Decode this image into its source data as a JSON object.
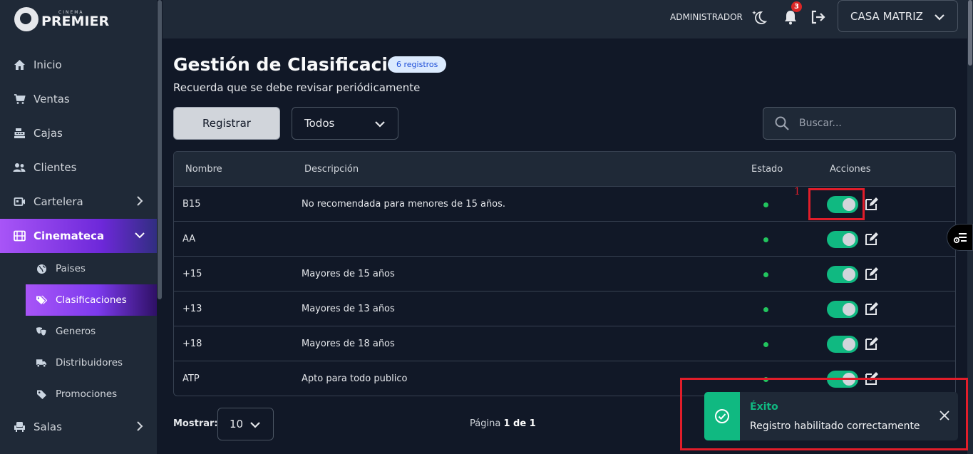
{
  "brand": {
    "small": "CINEMA",
    "big": "PREMIER"
  },
  "sidebar": {
    "items": [
      {
        "label": "Inicio",
        "icon": "home-icon"
      },
      {
        "label": "Ventas",
        "icon": "cart-icon"
      },
      {
        "label": "Cajas",
        "icon": "cash-register-icon"
      },
      {
        "label": "Clientes",
        "icon": "users-icon"
      },
      {
        "label": "Cartelera",
        "icon": "ticket-icon"
      },
      {
        "label": "Cinemateca",
        "icon": "film-icon"
      },
      {
        "label": "Salas",
        "icon": "chair-icon"
      }
    ],
    "subitems": [
      {
        "label": "Paises",
        "icon": "globe-icon"
      },
      {
        "label": "Clasificaciones",
        "icon": "tags-icon"
      },
      {
        "label": "Generos",
        "icon": "masks-icon"
      },
      {
        "label": "Distribuidores",
        "icon": "truck-icon"
      },
      {
        "label": "Promociones",
        "icon": "tag-icon"
      }
    ]
  },
  "topbar": {
    "user": "ADMINISTRADOR",
    "notifications": "3",
    "branch": "CASA MATRIZ"
  },
  "main": {
    "title": "Gestión de Clasificación",
    "count": "6 registros",
    "subtitle": "Recuerda que se debe revisar periódicamente",
    "register_label": "Registrar",
    "filter_value": "Todos",
    "search_placeholder": "Buscar...",
    "columns": {
      "name": "Nombre",
      "desc": "Descripción",
      "status": "Estado",
      "actions": "Acciones"
    },
    "rows": [
      {
        "name": "B15",
        "desc": "No recomendada para menores de 15 años."
      },
      {
        "name": "AA",
        "desc": ""
      },
      {
        "name": "+15",
        "desc": "Mayores de 15 años"
      },
      {
        "name": "+13",
        "desc": "Mayores de 13 años"
      },
      {
        "name": "+18",
        "desc": "Mayores de 18 años"
      },
      {
        "name": "ATP",
        "desc": "Apto para todo publico"
      }
    ],
    "show_label": "Mostrar:",
    "page_size": "10",
    "pager": {
      "prefix": "Página",
      "current": "1 de 1"
    }
  },
  "annotation": {
    "marker": "1"
  },
  "toast": {
    "title": "Éxito",
    "message": "Registro habilitado correctamente"
  },
  "colors": {
    "accent": "#a855f7",
    "success": "#10b981",
    "highlight": "#e11d2a"
  }
}
